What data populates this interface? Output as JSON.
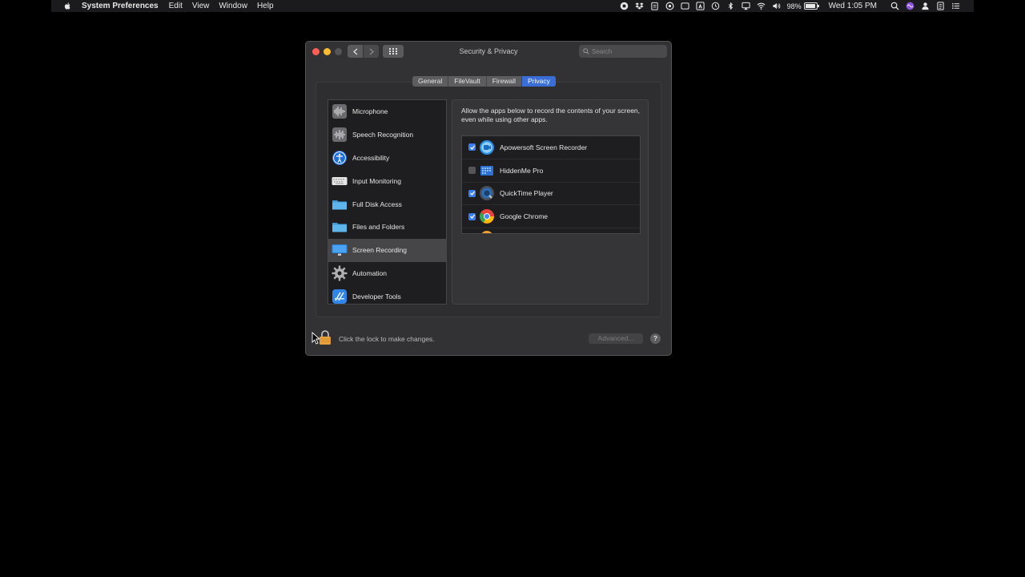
{
  "menubar": {
    "app_name": "System Preferences",
    "menus": [
      "Edit",
      "View",
      "Window",
      "Help"
    ],
    "status_icons": [
      "screen-record-icon",
      "dropbox-icon",
      "clipboard-icon",
      "circle-icon",
      "display-icon",
      "adobe-icon",
      "time-machine-icon",
      "bluetooth-icon",
      "airplay-icon",
      "wifi-icon",
      "volume-icon"
    ],
    "battery_percent": "98%",
    "battery_level": 0.98,
    "clock": "Wed 1:05 PM"
  },
  "window": {
    "title": "Security & Privacy",
    "search_placeholder": "Search",
    "tabs": [
      {
        "label": "General",
        "active": false
      },
      {
        "label": "FileVault",
        "active": false
      },
      {
        "label": "Firewall",
        "active": false
      },
      {
        "label": "Privacy",
        "active": true
      }
    ],
    "categories": [
      {
        "label": "Microphone",
        "icon": "microphone-icon",
        "selected": false
      },
      {
        "label": "Speech Recognition",
        "icon": "speech-recognition-icon",
        "selected": false
      },
      {
        "label": "Accessibility",
        "icon": "accessibility-icon",
        "selected": false
      },
      {
        "label": "Input Monitoring",
        "icon": "keyboard-icon",
        "selected": false
      },
      {
        "label": "Full Disk Access",
        "icon": "folder-icon",
        "selected": false
      },
      {
        "label": "Files and Folders",
        "icon": "folder-icon",
        "selected": false
      },
      {
        "label": "Screen Recording",
        "icon": "display-icon",
        "selected": true
      },
      {
        "label": "Automation",
        "icon": "gear-icon",
        "selected": false
      },
      {
        "label": "Developer Tools",
        "icon": "developer-tools-icon",
        "selected": false
      }
    ],
    "panel_description": "Allow the apps below to record the contents of your screen, even while using other apps.",
    "apps": [
      {
        "name": "Apowersoft Screen Recorder",
        "checked": true,
        "icon": "apowersoft-icon"
      },
      {
        "name": "HiddenMe Pro",
        "checked": false,
        "icon": "hiddenme-icon"
      },
      {
        "name": "QuickTime Player",
        "checked": true,
        "icon": "quicktime-icon"
      },
      {
        "name": "Google Chrome",
        "checked": true,
        "icon": "chrome-icon"
      }
    ],
    "lock_text": "Click the lock to make changes.",
    "advanced_label": "Advanced...",
    "help_label": "?"
  }
}
